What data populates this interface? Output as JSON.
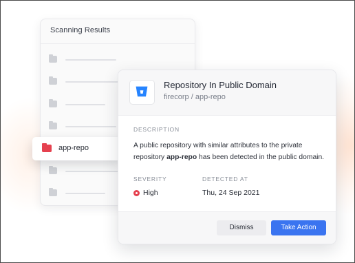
{
  "scan_panel": {
    "title": "Scanning Results",
    "highlighted_item": "app-repo"
  },
  "detail_card": {
    "icon": "bitbucket-icon",
    "title": "Repository In Public Domain",
    "subtitle": "firecorp / app-repo",
    "description_label": "DESCRIPTION",
    "description_before": "A public repository with similar attributes to the private repository ",
    "description_bold": "app-repo",
    "description_after": " has been detected in the public domain.",
    "severity_label": "SEVERITY",
    "severity_value": "High",
    "detected_label": "DETECTED AT",
    "detected_value": "Thu, 24 Sep 2021",
    "dismiss_label": "Dismiss",
    "action_label": "Take Action"
  },
  "colors": {
    "accent": "#3a74f0",
    "danger": "#e5414f",
    "bitbucket": "#2684ff"
  }
}
